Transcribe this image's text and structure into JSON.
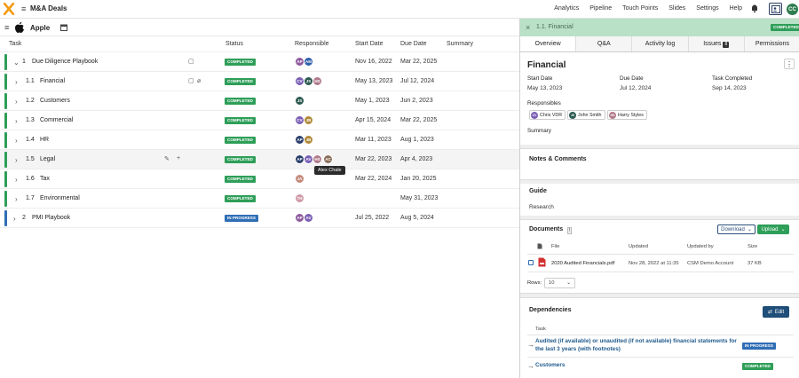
{
  "app": {
    "title": "M&A Deals"
  },
  "nav": [
    "Analytics",
    "Pipeline",
    "Touch Points",
    "Slides",
    "Settings",
    "Help"
  ],
  "user": {
    "initials": "CC"
  },
  "company": {
    "name": "Apple"
  },
  "table": {
    "headers": {
      "task": "Task",
      "status": "Status",
      "responsible": "Responsible",
      "start": "Start Date",
      "due": "Due Date",
      "summary": "Summary"
    },
    "rows": [
      {
        "chevron": "⌄",
        "num": "1",
        "name": "Due Diligence Playbook",
        "status": "COMPLETED",
        "start": "Nov 16, 2022",
        "due": "Mar 22, 2025",
        "bar": "#2e9e58",
        "avatars": [
          "AP",
          "AM"
        ]
      },
      {
        "chevron": "›",
        "num": "1.1",
        "name": "Financial",
        "status": "COMPLETED",
        "start": "May 13, 2023",
        "due": "Jul 12, 2024",
        "bar": "#2e9e58",
        "avatars": [
          "CV",
          "JS",
          "HS"
        ]
      },
      {
        "chevron": "›",
        "num": "1.2",
        "name": "Customers",
        "status": "COMPLETED",
        "start": "May 1, 2023",
        "due": "Jun 2, 2023",
        "bar": "#2e9e58",
        "avatars": [
          "JS"
        ]
      },
      {
        "chevron": "›",
        "num": "1.3",
        "name": "Commercial",
        "status": "COMPLETED",
        "start": "Apr 15, 2024",
        "due": "Mar 22, 2025",
        "bar": "#2e9e58",
        "avatars": [
          "CV",
          "JB"
        ]
      },
      {
        "chevron": "›",
        "num": "1.4",
        "name": "HR",
        "status": "COMPLETED",
        "start": "Mar 11, 2023",
        "due": "Aug 1, 2023",
        "bar": "#2e9e58",
        "avatars": [
          "AP",
          "JB"
        ]
      },
      {
        "chevron": "›",
        "num": "1.5",
        "name": "Legal",
        "status": "COMPLETED",
        "start": "Mar 22, 2023",
        "due": "Apr 4, 2023",
        "bar": "#2e9e58",
        "avatars": [
          "AP",
          "AV",
          "HS",
          "AC"
        ]
      },
      {
        "chevron": "›",
        "num": "1.6",
        "name": "Tax",
        "status": "COMPLETED",
        "start": "Mar 22, 2024",
        "due": "Jan 20, 2025",
        "bar": "#2e9e58",
        "avatars": [
          "JA"
        ]
      },
      {
        "chevron": "›",
        "num": "1.7",
        "name": "Environmental",
        "status": "COMPLETED",
        "start": "",
        "due": "May 31, 2023",
        "bar": "#2e9e58",
        "avatars": [
          "TH"
        ]
      },
      {
        "chevron": "›",
        "num": "2",
        "name": "PMI Playbook",
        "status": "IN PROGRESS",
        "start": "Jul 25, 2022",
        "due": "Aug 5, 2024",
        "bar": "#2f6eb5",
        "avatars": [
          "AP",
          "AV"
        ]
      }
    ],
    "tooltip": "Alex Chale"
  },
  "panel": {
    "breadcrumb": "1.1. Financial",
    "status": "COMPLETED",
    "tabs": [
      "Overview",
      "Q&A",
      "Activity log",
      "Issues",
      "Permissions"
    ],
    "issues_count": "8",
    "title": "Financial",
    "start_label": "Start Date",
    "start": "May 13, 2023",
    "due_label": "Due Date",
    "due": "Jul 12, 2024",
    "completed_label": "Task Completed",
    "completed": "Sep 14, 2023",
    "responsibles_label": "Responsibles",
    "responsibles": [
      {
        "initials": "CV",
        "name": "Chris VDR"
      },
      {
        "initials": "JS",
        "name": "John Smith"
      },
      {
        "initials": "HS",
        "name": "Harry Styles"
      }
    ],
    "summary_label": "Summary",
    "notes_label": "Notes & Comments",
    "guide_label": "Guide",
    "guide_value": "Research",
    "documents": {
      "label": "Documents",
      "download": "Download",
      "upload": "Upload",
      "cols": {
        "file": "File",
        "updated": "Updated",
        "updated_by": "Updated by",
        "size": "Size"
      },
      "rows": [
        {
          "file": "2020 Audited Financials.pdf",
          "updated": "Nov 28, 2022 at 11:35",
          "updated_by": "CSM Demo Account",
          "size": "37 KB"
        }
      ],
      "rows_label": "Rows:",
      "rows_value": "10"
    },
    "dependencies": {
      "label": "Dependencies",
      "edit": "Edit",
      "task_col": "Task",
      "items": [
        {
          "name": "Audited (if available) or unaudited (if not available) financial statements for the last 3 years (with footnotes)",
          "status": "IN PROGRESS"
        },
        {
          "name": "Customers",
          "status": "COMPLETED"
        }
      ]
    }
  },
  "colors": {
    "accent": "#2e9e58",
    "navy": "#1f4e79",
    "inprogress": "#2f6eb5",
    "header_green": "#b9e1c7"
  }
}
